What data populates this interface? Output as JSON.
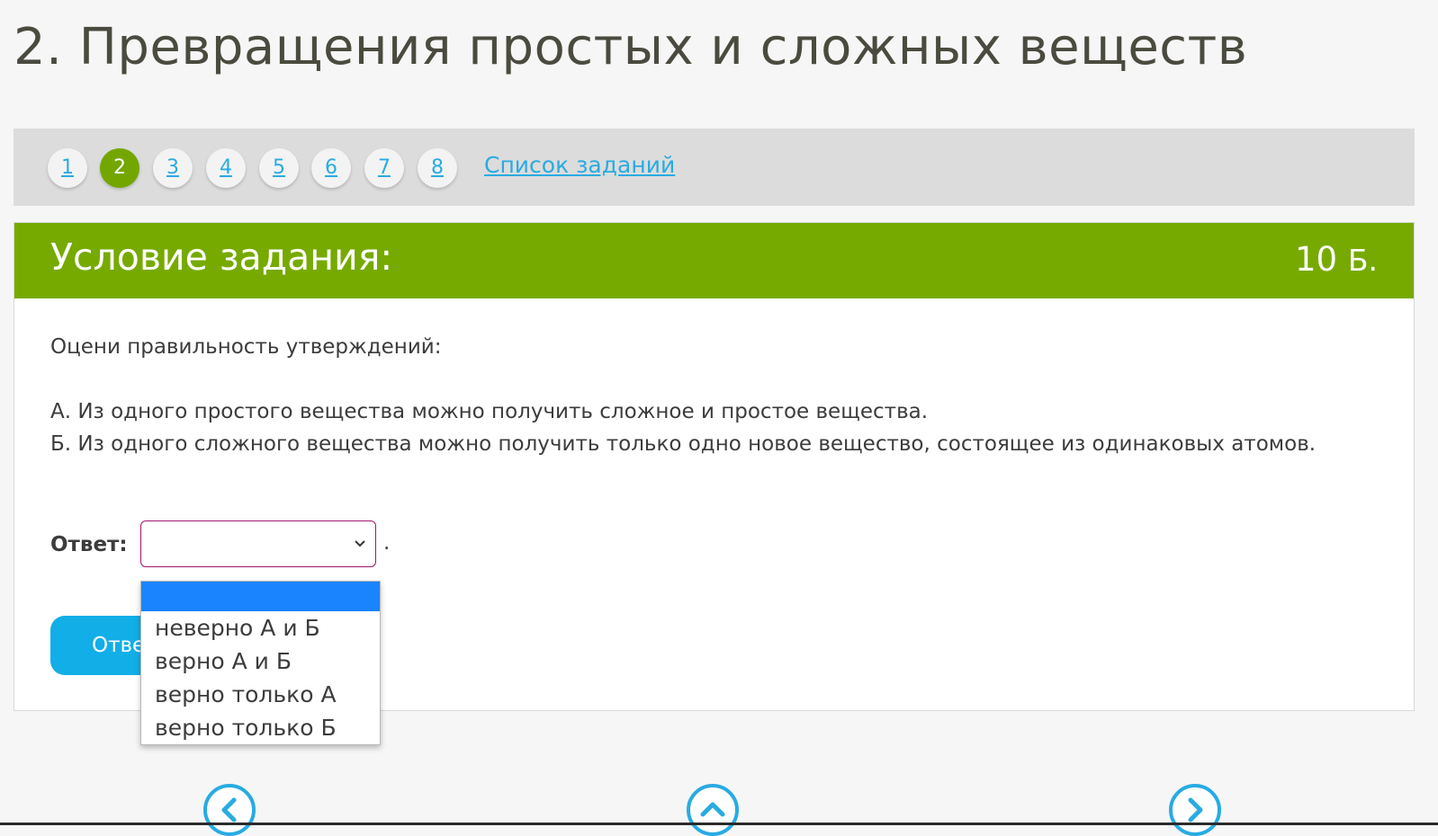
{
  "page": {
    "title": "2. Превращения простых и сложных веществ"
  },
  "pager": {
    "numbers": [
      "1",
      "2",
      "3",
      "4",
      "5",
      "6",
      "7",
      "8"
    ],
    "active_index": 1,
    "task_list_label": "Список заданий"
  },
  "task": {
    "header_title": "Условие задания:",
    "points_value": "10",
    "points_unit": "Б.",
    "prompt": "Оцени правильность утверждений:",
    "statement_a": "А. Из одного простого вещества можно получить сложное и простое вещества.",
    "statement_b": "Б. Из одного сложного вещества можно получить только одно новое вещество, состоящее из одинаковых атомов.",
    "answer_label": "Ответ:",
    "answer_selected": "",
    "answer_period": ".",
    "submit_label": "Ответить"
  },
  "dropdown": {
    "options": [
      "",
      "неверно А и Б",
      "верно А и Б",
      "верно только А",
      "верно только Б"
    ],
    "highlighted_index": 0
  },
  "nav": {
    "prev_icon": "chevron-left-icon",
    "top_icon": "chevron-up-icon",
    "next_icon": "chevron-right-icon"
  },
  "colors": {
    "accent_green": "#76aa00",
    "link_blue": "#29abe2",
    "button_blue": "#12aee8",
    "select_border": "#a3156e",
    "option_highlight": "#1a84ff"
  }
}
